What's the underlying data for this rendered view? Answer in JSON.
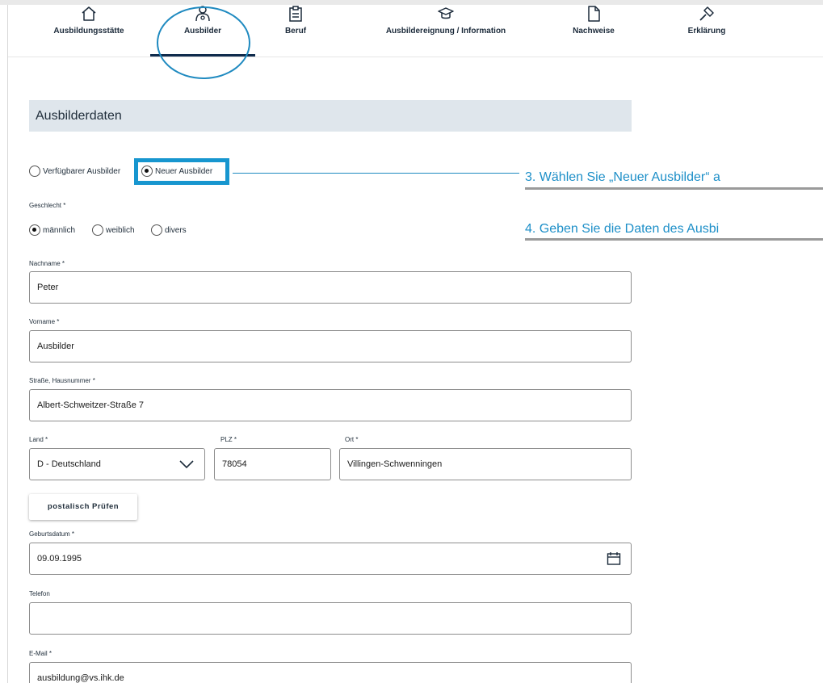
{
  "nav": {
    "items": [
      {
        "label": "Ausbildungsstätte",
        "icon": "home-icon"
      },
      {
        "label": "Ausbilder",
        "icon": "trainer-icon"
      },
      {
        "label": "Beruf",
        "icon": "clipboard-icon"
      },
      {
        "label": "Ausbildereignung / Information",
        "icon": "graduation-cap-icon"
      },
      {
        "label": "Nachweise",
        "icon": "document-icon"
      },
      {
        "label": "Erklärung",
        "icon": "gavel-icon"
      }
    ],
    "active_index": 1
  },
  "section_title": "Ausbilderdaten",
  "trainer_type": {
    "options": [
      "Verfügbarer Ausbilder",
      "Neuer Ausbilder"
    ],
    "selected": "Neuer Ausbilder"
  },
  "gender": {
    "label": "Geschlecht *",
    "options": [
      "männlich",
      "weiblich",
      "divers"
    ],
    "selected": "männlich"
  },
  "form": {
    "nachname": {
      "label": "Nachname *",
      "value": "Peter"
    },
    "vorname": {
      "label": "Vorname *",
      "value": "Ausbilder"
    },
    "strasse": {
      "label": "Straße, Hausnummer *",
      "value": "Albert-Schweitzer-Straße 7"
    },
    "land": {
      "label": "Land *",
      "value": "D - Deutschland"
    },
    "plz": {
      "label": "PLZ *",
      "value": "78054"
    },
    "ort": {
      "label": "Ort *",
      "value": "Villingen-Schwenningen"
    },
    "geburtsdatum": {
      "label": "Geburtsdatum *",
      "value": "09.09.1995"
    },
    "telefon": {
      "label": "Telefon",
      "value": ""
    },
    "email": {
      "label": "E-Mail *",
      "value": "ausbildung@vs.ihk.de"
    }
  },
  "check_button": "postalisch Prüfen",
  "callouts": {
    "step3": "3. Wählen Sie „Neuer Ausbilder“ a",
    "step4": "4. Geben Sie die Daten des Ausbi"
  },
  "colors": {
    "accent": "#1d8fc8",
    "nav_underline": "#0f2b4c",
    "section_bg": "#dfe6ec"
  }
}
